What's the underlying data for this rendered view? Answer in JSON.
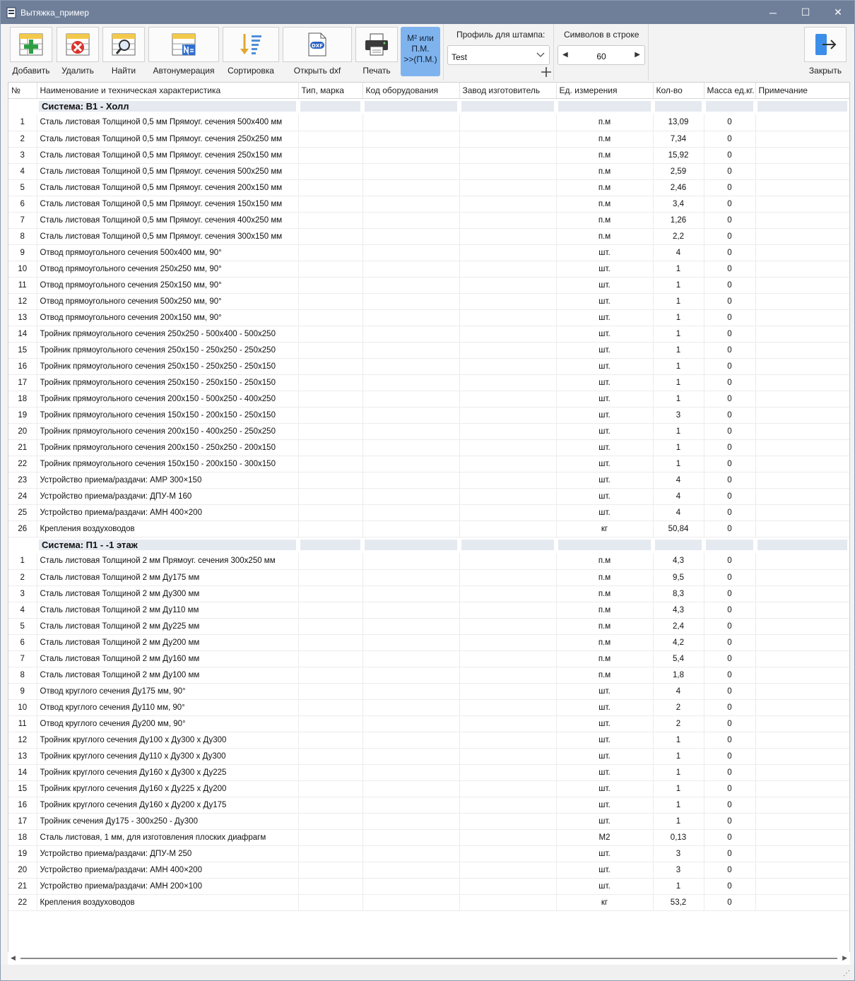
{
  "window": {
    "title": "Вытяжка_пример",
    "minimize": "─",
    "maximize": "☐",
    "close": "✕"
  },
  "toolbar": {
    "add": "Добавить",
    "delete": "Удалить",
    "find": "Найти",
    "autonumber": "Автонумерация",
    "sort": "Сортировка",
    "open_dxf": "Открыть dxf",
    "print": "Печать",
    "m2_line1": "М² или",
    "m2_line2": "П.М.",
    "m2_line3": ">>(П.М.)",
    "profile_label": "Профиль для штампа:",
    "profile_value": "Test",
    "symbols_label": "Символов в строке",
    "symbols_value": "60",
    "close": "Закрыть",
    "dxf_badge": "DXF"
  },
  "columns": [
    "№",
    "Наименование и техническая характеристика",
    "Тип, марка",
    "Код оборудования",
    "Завод изготовитель",
    "Ед. измерения",
    "Кол-во",
    "Масса ед.кг.",
    "Примечание"
  ],
  "systems": [
    {
      "name": "Система: В1 - Холл",
      "rows": [
        [
          "1",
          "Сталь листовая Толщиной 0,5 мм  Прямоуг. сечения 500х400 мм",
          "п.м",
          "13,09",
          "0"
        ],
        [
          "2",
          "Сталь листовая Толщиной 0,5 мм  Прямоуг. сечения 250х250 мм",
          "п.м",
          "7,34",
          "0"
        ],
        [
          "3",
          "Сталь листовая Толщиной 0,5 мм  Прямоуг. сечения 250х150 мм",
          "п.м",
          "15,92",
          "0"
        ],
        [
          "4",
          "Сталь листовая Толщиной 0,5 мм  Прямоуг. сечения 500х250 мм",
          "п.м",
          "2,59",
          "0"
        ],
        [
          "5",
          "Сталь листовая Толщиной 0,5 мм  Прямоуг. сечения 200х150 мм",
          "п.м",
          "2,46",
          "0"
        ],
        [
          "6",
          "Сталь листовая Толщиной 0,5 мм  Прямоуг. сечения 150х150 мм",
          "п.м",
          "3,4",
          "0"
        ],
        [
          "7",
          "Сталь листовая Толщиной 0,5 мм  Прямоуг. сечения 400х250 мм",
          "п.м",
          "1,26",
          "0"
        ],
        [
          "8",
          "Сталь листовая Толщиной 0,5 мм  Прямоуг. сечения 300х150 мм",
          "п.м",
          "2,2",
          "0"
        ],
        [
          "9",
          "Отвод прямоугольного сечения 500х400 мм, 90°",
          "шт.",
          "4",
          "0"
        ],
        [
          "10",
          "Отвод прямоугольного сечения 250х250 мм, 90°",
          "шт.",
          "1",
          "0"
        ],
        [
          "11",
          "Отвод прямоугольного сечения 250х150 мм, 90°",
          "шт.",
          "1",
          "0"
        ],
        [
          "12",
          "Отвод прямоугольного сечения 500х250 мм, 90°",
          "шт.",
          "1",
          "0"
        ],
        [
          "13",
          "Отвод прямоугольного сечения 200х150 мм, 90°",
          "шт.",
          "1",
          "0"
        ],
        [
          "14",
          "Тройник прямоугольного сечения 250х250 - 500х400 - 500х250",
          "шт.",
          "1",
          "0"
        ],
        [
          "15",
          "Тройник прямоугольного сечения 250х150 - 250х250 - 250х250",
          "шт.",
          "1",
          "0"
        ],
        [
          "16",
          "Тройник прямоугольного сечения 250х150 - 250х250 - 250х150",
          "шт.",
          "1",
          "0"
        ],
        [
          "17",
          "Тройник прямоугольного сечения 250х150 - 250х150 - 250х150",
          "шт.",
          "1",
          "0"
        ],
        [
          "18",
          "Тройник прямоугольного сечения 200х150 - 500х250 - 400х250",
          "шт.",
          "1",
          "0"
        ],
        [
          "19",
          "Тройник прямоугольного сечения 150х150 - 200х150 - 250х150",
          "шт.",
          "3",
          "0"
        ],
        [
          "20",
          "Тройник прямоугольного сечения 200х150 - 400х250 - 250х250",
          "шт.",
          "1",
          "0"
        ],
        [
          "21",
          "Тройник прямоугольного сечения 200х150 - 250х250 - 200х150",
          "шт.",
          "1",
          "0"
        ],
        [
          "22",
          "Тройник прямоугольного сечения 150х150 - 200х150 - 300х150",
          "шт.",
          "1",
          "0"
        ],
        [
          "23",
          "Устройство приема/раздачи: АМР 300×150",
          "шт.",
          "4",
          "0"
        ],
        [
          "24",
          "Устройство приема/раздачи: ДПУ-М 160",
          "шт.",
          "4",
          "0"
        ],
        [
          "25",
          "Устройство приема/раздачи: АМН 400×200",
          "шт.",
          "4",
          "0"
        ],
        [
          "26",
          "Крепления воздуховодов",
          "кг",
          "50,84",
          "0"
        ]
      ]
    },
    {
      "name": "Система: П1 - -1 этаж",
      "rows": [
        [
          "1",
          "Сталь листовая Толщиной 2 мм  Прямоуг. сечения 300х250 мм",
          "п.м",
          "4,3",
          "0"
        ],
        [
          "2",
          "Сталь листовая Толщиной 2 мм  Ду175 мм",
          "п.м",
          "9,5",
          "0"
        ],
        [
          "3",
          "Сталь листовая Толщиной 2 мм  Ду300 мм",
          "п.м",
          "8,3",
          "0"
        ],
        [
          "4",
          "Сталь листовая Толщиной 2 мм  Ду110 мм",
          "п.м",
          "4,3",
          "0"
        ],
        [
          "5",
          "Сталь листовая Толщиной 2 мм  Ду225 мм",
          "п.м",
          "2,4",
          "0"
        ],
        [
          "6",
          "Сталь листовая Толщиной 2 мм  Ду200 мм",
          "п.м",
          "4,2",
          "0"
        ],
        [
          "7",
          "Сталь листовая Толщиной 2 мм  Ду160 мм",
          "п.м",
          "5,4",
          "0"
        ],
        [
          "8",
          "Сталь листовая Толщиной 2 мм  Ду100 мм",
          "п.м",
          "1,8",
          "0"
        ],
        [
          "9",
          "Отвод круглого сечения Ду175 мм, 90°",
          "шт.",
          "4",
          "0"
        ],
        [
          "10",
          "Отвод круглого сечения Ду110 мм, 90°",
          "шт.",
          "2",
          "0"
        ],
        [
          "11",
          "Отвод круглого сечения Ду200 мм, 90°",
          "шт.",
          "2",
          "0"
        ],
        [
          "12",
          "Тройник круглого сечения Ду100 х Ду300 х Ду300",
          "шт.",
          "1",
          "0"
        ],
        [
          "13",
          "Тройник круглого сечения Ду110 х Ду300 х Ду300",
          "шт.",
          "1",
          "0"
        ],
        [
          "14",
          "Тройник круглого сечения Ду160 х Ду300 х Ду225",
          "шт.",
          "1",
          "0"
        ],
        [
          "15",
          "Тройник круглого сечения Ду160 х Ду225 х Ду200",
          "шт.",
          "1",
          "0"
        ],
        [
          "16",
          "Тройник круглого сечения Ду160 х Ду200 х Ду175",
          "шт.",
          "1",
          "0"
        ],
        [
          "17",
          "Тройник сечения Ду175 - 300х250 - Ду300",
          "шт.",
          "1",
          "0"
        ],
        [
          "18",
          "Сталь листовая, 1 мм, для изготовления плоских диафрагм",
          "М2",
          "0,13",
          "0"
        ],
        [
          "19",
          "Устройство приема/раздачи: ДПУ-М 250",
          "шт.",
          "3",
          "0"
        ],
        [
          "20",
          "Устройство приема/раздачи: АМН 400×200",
          "шт.",
          "3",
          "0"
        ],
        [
          "21",
          "Устройство приема/раздачи: АМН 200×100",
          "шт.",
          "1",
          "0"
        ],
        [
          "22",
          "Крепления воздуховодов",
          "кг",
          "53,2",
          "0"
        ]
      ]
    }
  ]
}
